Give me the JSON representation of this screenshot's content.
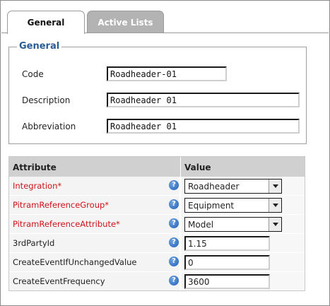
{
  "tabs": [
    {
      "label": "General",
      "active": true
    },
    {
      "label": "Active Lists",
      "active": false
    }
  ],
  "general": {
    "legend": "General",
    "code_label": "Code",
    "code_value": "Roadheader-01",
    "description_label": "Description",
    "description_value": "Roadheader 01",
    "abbreviation_label": "Abbreviation",
    "abbreviation_value": "Roadheader 01"
  },
  "attributes": {
    "header_attribute": "Attribute",
    "header_value": "Value",
    "help_glyph": "?",
    "rows": [
      {
        "name": "Integration*",
        "required": true,
        "type": "select",
        "value": "Roadheader"
      },
      {
        "name": "PitramReferenceGroup*",
        "required": true,
        "type": "select",
        "value": "Equipment"
      },
      {
        "name": "PitramReferenceAttribute*",
        "required": true,
        "type": "select",
        "value": "Model"
      },
      {
        "name": "3rdPartyId",
        "required": false,
        "type": "text",
        "value": "1.15"
      },
      {
        "name": "CreateEventIfUnchangedValue",
        "required": false,
        "type": "text",
        "value": "0"
      },
      {
        "name": "CreateEventFrequency",
        "required": false,
        "type": "text",
        "value": "3600"
      }
    ]
  },
  "colors": {
    "legend": "#2a5b95",
    "required": "#d0121b",
    "inactive_tab": "#b3b3b3",
    "grid_header": "#d0d0d0",
    "help_icon": "#1f5fb8"
  },
  "icons": {
    "help": "help-icon",
    "dropdown": "chevron-down-icon"
  }
}
